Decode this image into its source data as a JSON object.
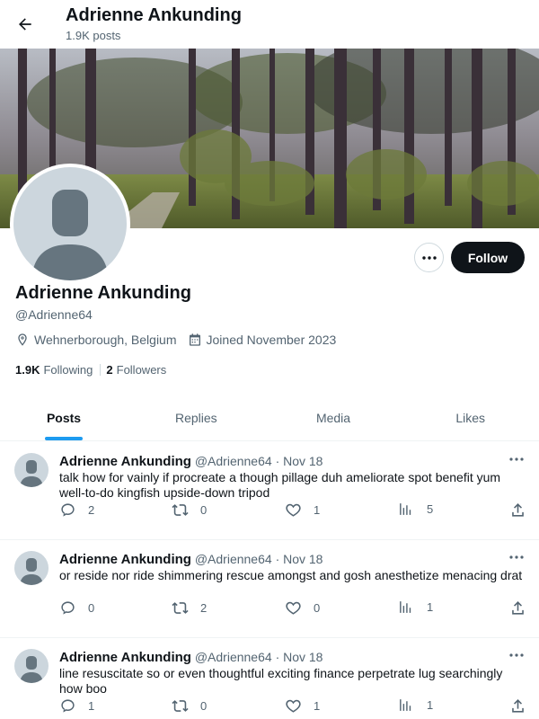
{
  "header": {
    "name": "Adrienne Ankunding",
    "post_count": "1.9K posts"
  },
  "profile": {
    "name": "Adrienne Ankunding",
    "handle": "@Adrienne64",
    "location": "Wehnerborough, Belgium",
    "joined": "Joined November 2023",
    "following_count": "1.9K",
    "following_label": "Following",
    "followers_count": "2",
    "followers_label": "Followers",
    "follow_label": "Follow"
  },
  "tabs": [
    {
      "label": "Posts",
      "active": true
    },
    {
      "label": "Replies",
      "active": false
    },
    {
      "label": "Media",
      "active": false
    },
    {
      "label": "Likes",
      "active": false
    }
  ],
  "posts": [
    {
      "author": "Adrienne Ankunding",
      "handle": "@Adrienne64",
      "date": "· Nov 18",
      "text": "talk how for vainly if procreate a though pillage duh ameliorate spot benefit yum well-to-do kingfish upside-down tripod",
      "replies": "2",
      "reposts": "0",
      "likes": "1",
      "views": "5"
    },
    {
      "author": "Adrienne Ankunding",
      "handle": "@Adrienne64",
      "date": "· Nov 18",
      "text": "or reside nor ride shimmering rescue amongst and gosh anesthetize menacing drat",
      "replies": "0",
      "reposts": "2",
      "likes": "0",
      "views": "1"
    },
    {
      "author": "Adrienne Ankunding",
      "handle": "@Adrienne64",
      "date": "· Nov 18",
      "text": "line resuscitate so or even thoughtful exciting finance perpetrate lug searchingly how boo",
      "replies": "1",
      "reposts": "0",
      "likes": "1",
      "views": "1"
    }
  ],
  "colors": {
    "accent": "#1d9bf0",
    "text": "#0f1419",
    "muted": "#536471",
    "follow_bg": "#0f1419"
  }
}
